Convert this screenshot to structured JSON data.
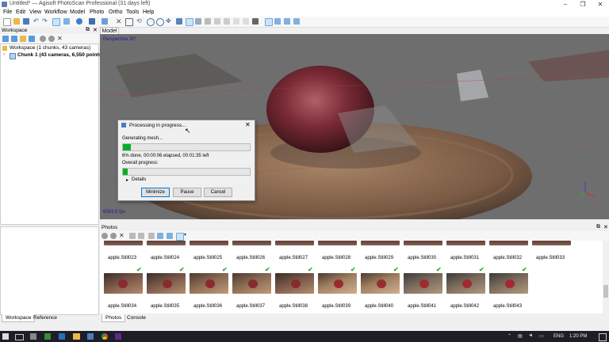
{
  "window": {
    "title": "Untitled* — Agisoft PhotoScan Professional (31 days left)"
  },
  "menu": [
    "File",
    "Edit",
    "View",
    "Workflow",
    "Model",
    "Photo",
    "Ortho",
    "Tools",
    "Help"
  ],
  "workspace": {
    "header": "Workspace",
    "root": "Workspace (1 chunks, 43 cameras)",
    "chunk": "Chunk 1 (43 cameras, 6,550 points)"
  },
  "model": {
    "tab": "Model",
    "perspective": "Perspective 30°",
    "scale_readout": "6563.5 fps"
  },
  "dialog": {
    "title": "Processing in progress...",
    "stage": "Generating mesh...",
    "stage_progress": 0.06,
    "status": "6% done, 00:00:06 elapsed, 00:01:35 left",
    "overall_label": "Overall progress:",
    "overall_progress": 0.04,
    "details": "Details",
    "buttons": {
      "minimize": "Minimize",
      "pause": "Pause",
      "cancel": "Cancel"
    }
  },
  "photos": {
    "header": "Photos",
    "row1": [
      "apple.Still023",
      "apple.Still024",
      "apple.Still025",
      "apple.Still026",
      "apple.Still027",
      "apple.Still028",
      "apple.Still029",
      "apple.Still030",
      "apple.Still031",
      "apple.Still032",
      "apple.Still033"
    ],
    "row2": [
      "apple.Still034",
      "apple.Still035",
      "apple.Still036",
      "apple.Still037",
      "apple.Still038",
      "apple.Still039",
      "apple.Still040",
      "apple.Still041",
      "apple.Still042",
      "apple.Still043"
    ]
  },
  "tabs": {
    "left": [
      "Workspace",
      "Reference"
    ],
    "bottom": [
      "Photos",
      "Console"
    ]
  },
  "taskbar": {
    "language": "ENG",
    "time": "1:20 PM"
  },
  "colors": {
    "progress": "#06b025",
    "selection": "#cce4f7",
    "taskbar": "#1e1e28"
  }
}
